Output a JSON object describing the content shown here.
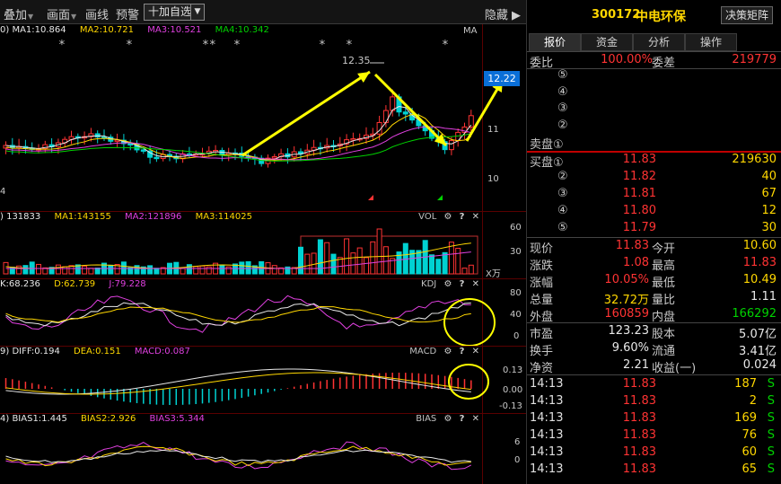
{
  "toolbar": {
    "items": [
      "叠加",
      "画面",
      "画线",
      "预警"
    ],
    "add_label": "十加自选",
    "hide_label": "隐藏"
  },
  "price_pane": {
    "ma_labels": [
      {
        "text": "0) MA1:10.864",
        "color": "#e8e8e8"
      },
      {
        "text": "MA2:10.721",
        "color": "#ffd700"
      },
      {
        "text": "MA3:10.521",
        "color": "#e040e0"
      },
      {
        "text": "MA4:10.342",
        "color": "#00d200"
      }
    ],
    "ma_tag": "MA",
    "y_ticks": [
      "11",
      "10"
    ],
    "left_edge_label": "4",
    "current_price_tag": "12.22",
    "peak_label": "12.35",
    "star_marks": [
      "*",
      "*",
      "**",
      "*",
      "*",
      "*",
      "*"
    ]
  },
  "vol_pane": {
    "labels": [
      {
        "text": ") 131833",
        "color": "#e8e8e8"
      },
      {
        "text": "MA1:143155",
        "color": "#ffd700"
      },
      {
        "text": "MA2:121896",
        "color": "#e040e0"
      },
      {
        "text": "MA3:114025",
        "color": "#ffd700"
      }
    ],
    "name": "VOL",
    "y_ticks": [
      "60",
      "30"
    ],
    "unit": "X万"
  },
  "kdj_pane": {
    "labels": [
      {
        "text": "K:68.236",
        "color": "#e8e8e8"
      },
      {
        "text": "D:62.739",
        "color": "#ffd700"
      },
      {
        "text": "J:79.228",
        "color": "#e040e0"
      }
    ],
    "name": "KDJ",
    "y_ticks": [
      "80",
      "40",
      "0"
    ]
  },
  "macd_pane": {
    "labels": [
      {
        "text": "9) DIFF:0.194",
        "color": "#e8e8e8"
      },
      {
        "text": "DEA:0.151",
        "color": "#ffd700"
      },
      {
        "text": "MACD:0.087",
        "color": "#e040e0"
      }
    ],
    "name": "MACD",
    "y_ticks": [
      "0.13",
      "0.00",
      "-0.13"
    ]
  },
  "bias_pane": {
    "labels": [
      {
        "text": "4) BIAS1:1.445",
        "color": "#e8e8e8"
      },
      {
        "text": "BIAS2:2.926",
        "color": "#ffd700"
      },
      {
        "text": "BIAS3:5.344",
        "color": "#e040e0"
      }
    ],
    "name": "BIAS",
    "y_ticks": [
      "6",
      "0"
    ]
  },
  "stock": {
    "code": "300172",
    "name": "中电环保",
    "decision_button": "决策矩阵"
  },
  "tabs": [
    "报价",
    "资金",
    "分析",
    "操作"
  ],
  "weibi": {
    "label": "委比",
    "value": "100.00%",
    "label2": "委差",
    "value2": "219779"
  },
  "sell_orders": [
    {
      "level": "⑤",
      "price": "",
      "vol": ""
    },
    {
      "level": "④",
      "price": "",
      "vol": ""
    },
    {
      "level": "③",
      "price": "",
      "vol": ""
    },
    {
      "level": "②",
      "price": "",
      "vol": ""
    },
    {
      "level": "卖盘①",
      "price": "",
      "vol": ""
    }
  ],
  "buy_orders": [
    {
      "level": "买盘①",
      "price": "11.83",
      "vol": "219630"
    },
    {
      "level": "②",
      "price": "11.82",
      "vol": "40"
    },
    {
      "level": "③",
      "price": "11.81",
      "vol": "67"
    },
    {
      "level": "④",
      "price": "11.80",
      "vol": "12"
    },
    {
      "level": "⑤",
      "price": "11.79",
      "vol": "30"
    }
  ],
  "quote_rows": [
    {
      "l1": "现价",
      "v1": "11.83",
      "c1": "red",
      "l2": "今开",
      "v2": "10.60",
      "c2": "yellow"
    },
    {
      "l1": "涨跌",
      "v1": "1.08",
      "c1": "red",
      "l2": "最高",
      "v2": "11.83",
      "c2": "red"
    },
    {
      "l1": "涨幅",
      "v1": "10.05%",
      "c1": "red",
      "l2": "最低",
      "v2": "10.49",
      "c2": "yellow"
    },
    {
      "l1": "总量",
      "v1": "32.72万",
      "c1": "yellow",
      "l2": "量比",
      "v2": "1.11",
      "c2": "white"
    },
    {
      "l1": "外盘",
      "v1": "160859",
      "c1": "red",
      "l2": "内盘",
      "v2": "166292",
      "c2": "green"
    }
  ],
  "fund_rows": [
    {
      "l1": "市盈",
      "v1": "123.23",
      "c1": "white",
      "l2": "股本",
      "v2": "5.07亿",
      "c2": "white"
    },
    {
      "l1": "换手",
      "v1": "9.60%",
      "c1": "white",
      "l2": "流通",
      "v2": "3.41亿",
      "c2": "white"
    },
    {
      "l1": "净资",
      "v1": "2.21",
      "c1": "white",
      "l2": "收益(一)",
      "v2": "0.024",
      "c2": "white"
    }
  ],
  "ticks": [
    {
      "time": "14:13",
      "price": "11.83",
      "vol": "187",
      "side": "S"
    },
    {
      "time": "14:13",
      "price": "11.83",
      "vol": "2",
      "side": "S"
    },
    {
      "time": "14:13",
      "price": "11.83",
      "vol": "169",
      "side": "S"
    },
    {
      "time": "14:13",
      "price": "11.83",
      "vol": "76",
      "side": "S"
    },
    {
      "time": "14:13",
      "price": "11.83",
      "vol": "60",
      "side": "S"
    },
    {
      "time": "14:13",
      "price": "11.83",
      "vol": "65",
      "side": "S"
    }
  ],
  "colors": {
    "up": "#ff3333",
    "down": "#00d2d2",
    "ma1": "#e8e8e8",
    "ma2": "#ffd700",
    "ma3": "#e040e0",
    "ma4": "#00d200",
    "annotation": "#ffff00",
    "price_tag": "#0a6fd8"
  }
}
